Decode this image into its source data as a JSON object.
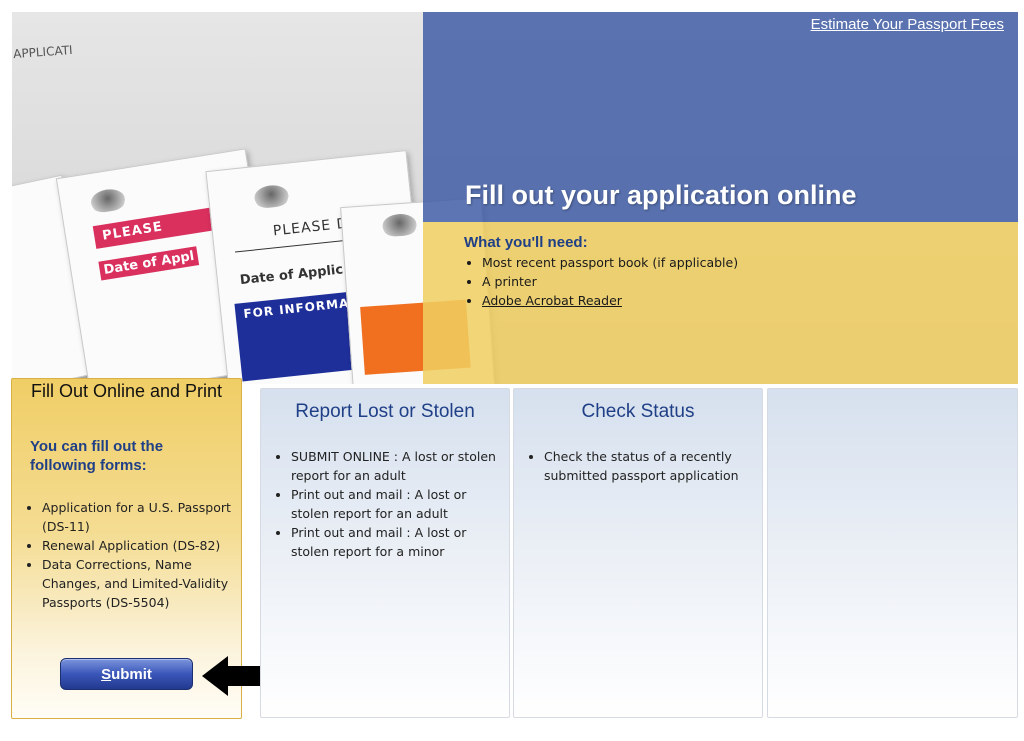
{
  "hero": {
    "fees_link": "Estimate Your Passport Fees",
    "title": "Fill out your application online",
    "need_title": "What you'll need:",
    "need_items": [
      "Most recent passport book (if applicable)",
      "A printer",
      "Adobe Acrobat Reader"
    ],
    "docs": {
      "banner1": "PLEASE",
      "banner2": "PLEASE D",
      "date1": "Date of Appl",
      "date2": "Date of Applic",
      "info": "FOR INFORMAT",
      "appl": "APPLICATI"
    }
  },
  "print_card": {
    "title": "Fill Out Online and Print",
    "forms_head": "You can fill out the following forms:",
    "items": [
      "Application for a U.S. Passport (DS-11)",
      "Renewal Application (DS-82)",
      "Data Corrections, Name Changes, and Limited-Validity Passports (DS-5504)"
    ],
    "submit_first": "S",
    "submit_rest": "ubmit"
  },
  "lost_card": {
    "title": "Report Lost or Stolen",
    "items": [
      "SUBMIT ONLINE : A lost or stolen report for an adult",
      "Print out and mail : A lost or stolen report for an adult",
      "Print out and mail : A lost or stolen report for a minor"
    ]
  },
  "status_card": {
    "title": "Check Status",
    "items": [
      "Check the status of a recently submitted passport application"
    ]
  },
  "colors": {
    "accent_blue": "#1f3f87",
    "hero_blue": "#425ea6",
    "hero_yellow": "#f0ce60",
    "submit_blue": "#3a56b8"
  }
}
